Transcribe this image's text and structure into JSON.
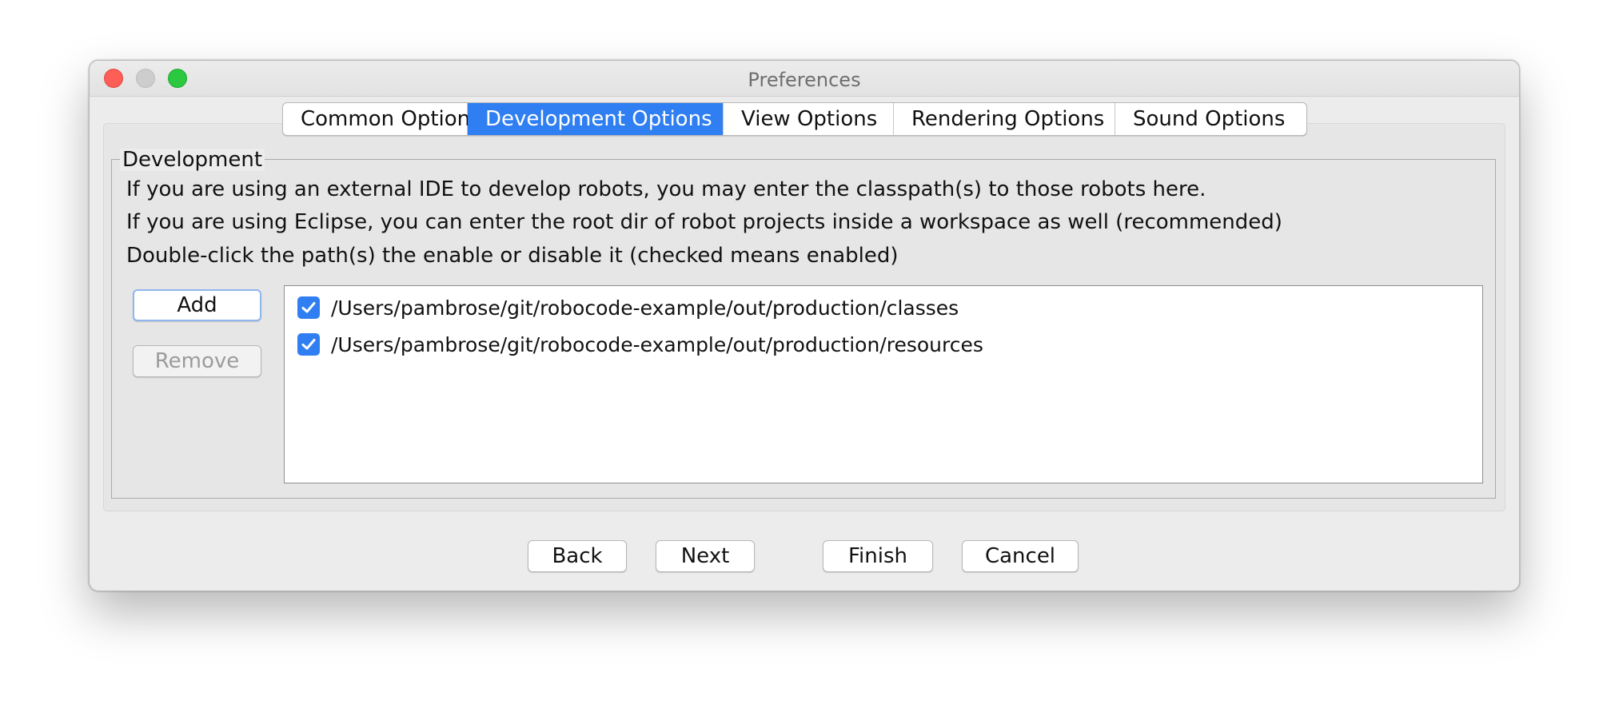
{
  "window": {
    "title": "Preferences"
  },
  "tabs": [
    {
      "label": "Common Options",
      "active": false
    },
    {
      "label": "Development Options",
      "active": true
    },
    {
      "label": "View Options",
      "active": false
    },
    {
      "label": "Rendering Options",
      "active": false
    },
    {
      "label": "Sound Options",
      "active": false
    }
  ],
  "development": {
    "group_title": "Development",
    "info_lines": [
      "If you are using an external IDE to develop robots, you may enter the classpath(s) to those robots here.",
      "If you are using Eclipse, you can enter the root dir of robot projects inside a workspace as well (recommended)",
      "Double-click the path(s) the enable or disable it (checked means enabled)"
    ],
    "add_label": "Add",
    "remove_label": "Remove",
    "paths": [
      {
        "path": "/Users/pambrose/git/robocode-example/out/production/classes",
        "checked": true
      },
      {
        "path": "/Users/pambrose/git/robocode-example/out/production/resources",
        "checked": true
      }
    ]
  },
  "footer": {
    "back_label": "Back",
    "next_label": "Next",
    "finish_label": "Finish",
    "cancel_label": "Cancel"
  },
  "colors": {
    "accent": "#2f7ff2",
    "close": "#fd5f57",
    "minimize": "#cdcdcd",
    "maximize": "#2bc840"
  }
}
